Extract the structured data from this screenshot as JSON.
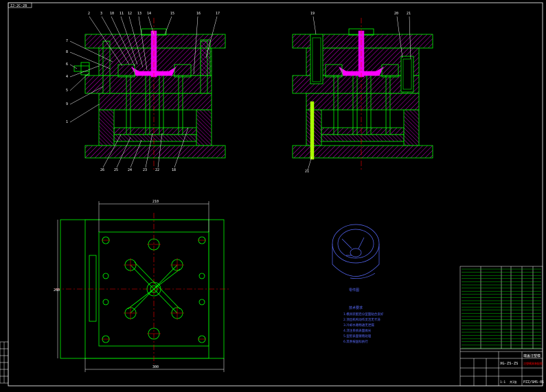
{
  "sheet": {
    "corner_code": "ZJ-2C-2B",
    "background": "#000000"
  },
  "colors": {
    "plate_outline": "#00ff00",
    "hatch": "#ff00ff",
    "sprue": "#ff00ff",
    "centerline": "#ff0000",
    "leaders": "#ffffff",
    "part_3d": "#5a6cff",
    "ejector_highlight": "#aaff00"
  },
  "views": {
    "left_section": {
      "top_callouts": [
        "2",
        "3",
        "10",
        "11",
        "12",
        "13",
        "14",
        "15",
        "16",
        "17"
      ],
      "left_callouts": [
        "7",
        "8",
        "6",
        "4",
        "5",
        "9",
        "1"
      ],
      "bottom_callouts": [
        "26",
        "25",
        "24",
        "23",
        "22",
        "18"
      ]
    },
    "right_section": {
      "top_callouts": [
        "19",
        "20",
        "21"
      ],
      "bottom_callouts": [
        "21"
      ]
    },
    "plan": {
      "dim_top": "210",
      "dim_bottom": "300",
      "dim_left": "260"
    },
    "part_label": "零件图"
  },
  "notes": {
    "title": "技术要求",
    "lines": [
      "1.模具装配后分型面贴合良好",
      "2.顶出机构动作灵活无卡滞",
      "3.冷却水路畅通无泄漏",
      "4.浇注系统表面抛光",
      "5.型腔表面镀铬处理",
      "6.其余按国标执行"
    ]
  },
  "title_block": {
    "drawing_no": "XG-ZS-ZS",
    "title": "端盖注塑模",
    "subtitle": "注塑模具装配图",
    "code": "PZZ/SHS-01",
    "scale": "1:1",
    "sheet": "共1张"
  }
}
